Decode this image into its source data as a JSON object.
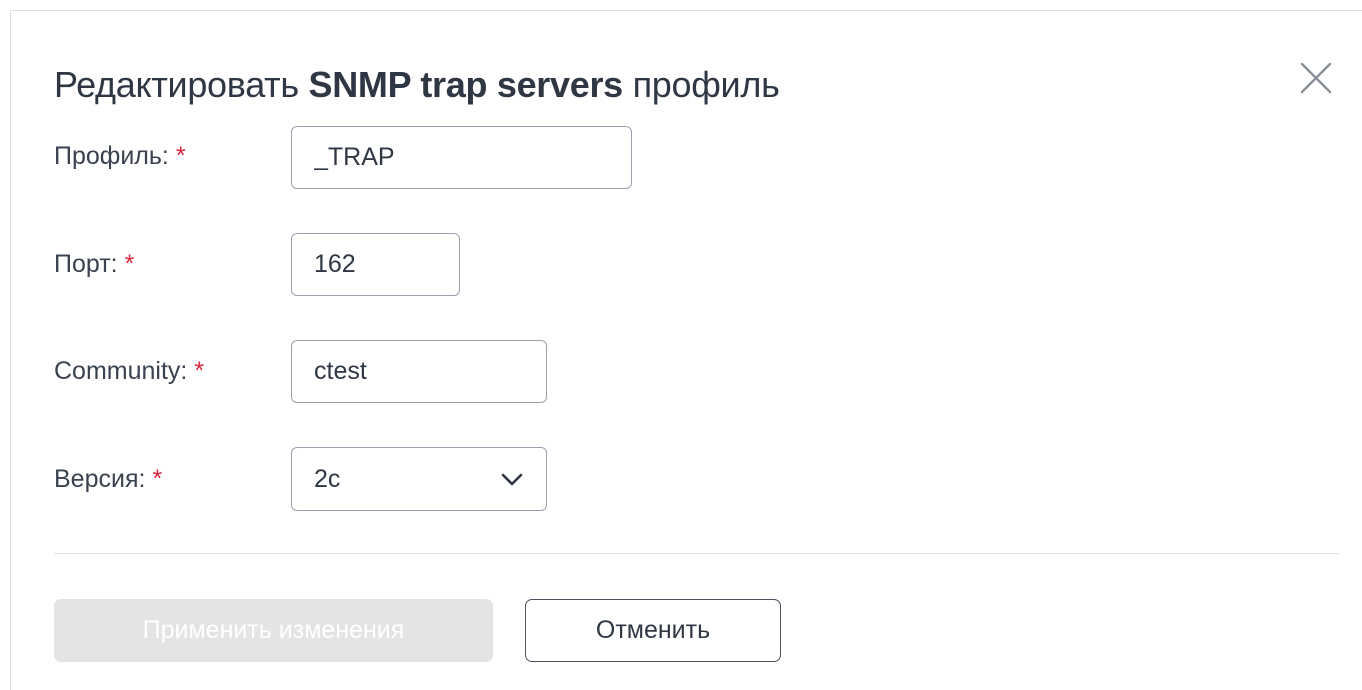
{
  "dialog": {
    "title_prefix": "Редактировать ",
    "title_bold": "SNMP trap servers",
    "title_suffix": " профиль"
  },
  "form": {
    "required_mark": "*",
    "profile": {
      "label": "Профиль:",
      "value": "_TRAP"
    },
    "port": {
      "label": "Порт:",
      "value": "162"
    },
    "community": {
      "label": "Community:",
      "value": "ctest"
    },
    "version": {
      "label": "Версия:",
      "value": "2c"
    }
  },
  "buttons": {
    "apply_label": "Применить изменения",
    "apply_disabled": true,
    "cancel_label": "Отменить"
  },
  "icons": {
    "close": "close-icon",
    "dropdown": "chevron-down-icon"
  },
  "colors": {
    "required": "#d9263d",
    "text": "#2f3744",
    "disabled_button": "#e3e4e6"
  }
}
